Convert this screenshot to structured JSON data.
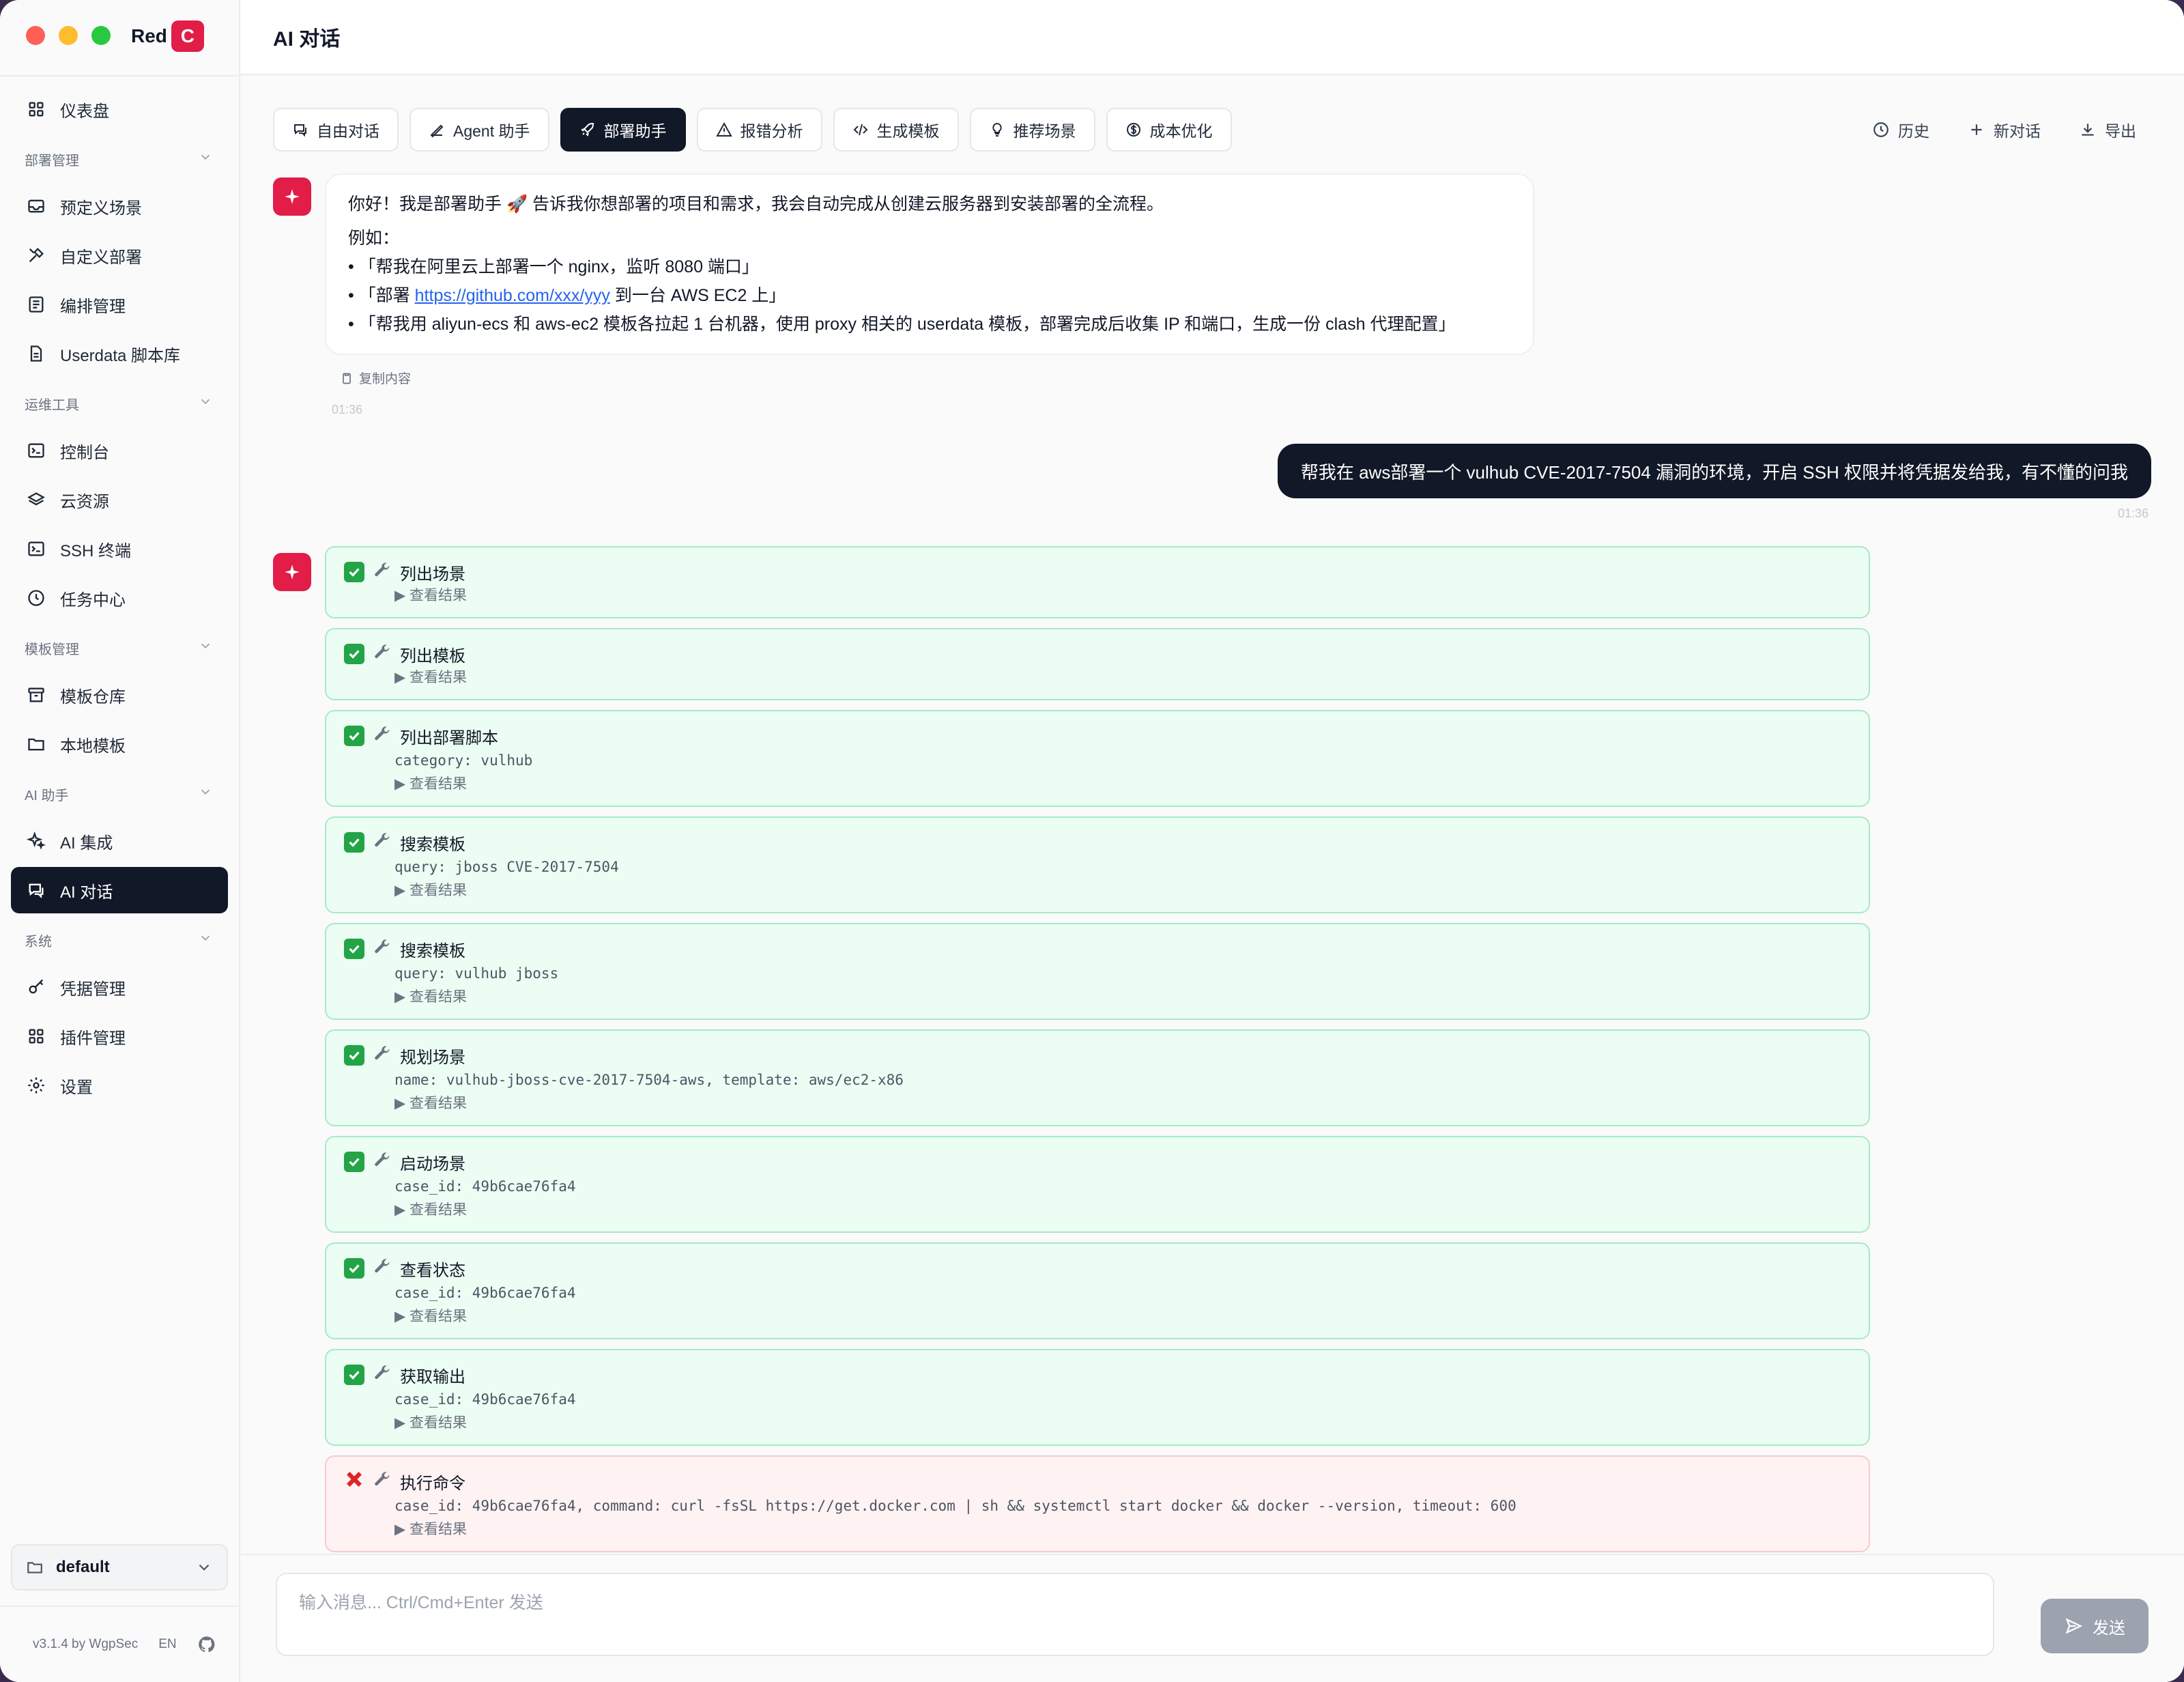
{
  "colors": {
    "accent": "#e11d48",
    "dark": "#111827",
    "success_bg": "#ecfdf3",
    "error_bg": "#fef2f2"
  },
  "app": {
    "logo_text": "Red",
    "logo_badge": "C"
  },
  "sidebar": {
    "top_item": {
      "label": "仪表盘",
      "icon": "grid-icon"
    },
    "sections": [
      {
        "title": "部署管理",
        "items": [
          {
            "label": "预定义场景",
            "icon": "inbox-icon"
          },
          {
            "label": "自定义部署",
            "icon": "tools-icon"
          },
          {
            "label": "编排管理",
            "icon": "list-icon"
          },
          {
            "label": "Userdata 脚本库",
            "icon": "file-icon"
          }
        ]
      },
      {
        "title": "运维工具",
        "items": [
          {
            "label": "控制台",
            "icon": "terminal-icon"
          },
          {
            "label": "云资源",
            "icon": "layers-icon"
          },
          {
            "label": "SSH 终端",
            "icon": "terminal-icon"
          },
          {
            "label": "任务中心",
            "icon": "clock-icon"
          }
        ]
      },
      {
        "title": "模板管理",
        "items": [
          {
            "label": "模板仓库",
            "icon": "archive-icon"
          },
          {
            "label": "本地模板",
            "icon": "folder-icon"
          }
        ]
      },
      {
        "title": "AI 助手",
        "items": [
          {
            "label": "AI 集成",
            "icon": "sparkles-icon"
          },
          {
            "label": "AI 对话",
            "icon": "chat-icon",
            "active": true
          }
        ]
      },
      {
        "title": "系统",
        "items": [
          {
            "label": "凭据管理",
            "icon": "key-icon"
          },
          {
            "label": "插件管理",
            "icon": "grid-icon"
          },
          {
            "label": "设置",
            "icon": "gear-icon"
          }
        ]
      }
    ],
    "workspace": "default",
    "version": "v3.1.4 by WgpSec",
    "lang": "EN"
  },
  "header": {
    "title": "AI 对话"
  },
  "modes": [
    {
      "label": "自由对话",
      "icon": "chat-icon"
    },
    {
      "label": "Agent 助手",
      "icon": "agent-icon"
    },
    {
      "label": "部署助手",
      "icon": "rocket-icon",
      "active": true
    },
    {
      "label": "报错分析",
      "icon": "warning-icon"
    },
    {
      "label": "生成模板",
      "icon": "code-icon"
    },
    {
      "label": "推荐场景",
      "icon": "bulb-icon"
    },
    {
      "label": "成本优化",
      "icon": "dollar-icon"
    }
  ],
  "actions": {
    "history": "历史",
    "new_chat": "新对话",
    "export": "导出"
  },
  "assistant_msg": {
    "intro": "你好！我是部署助手 🚀 告诉我你想部署的项目和需求，我会自动完成从创建云服务器到安装部署的全流程。",
    "example_label": "例如：",
    "ex1": "• 「帮我在阿里云上部署一个 nginx，监听 8080 端口」",
    "ex2_pre": "• 「部署 ",
    "ex2_link": "https://github.com/xxx/yyy",
    "ex2_post": " 到一台 AWS EC2 上」",
    "ex3": "• 「帮我用 aliyun-ecs 和 aws-ec2 模板各拉起 1 台机器，使用 proxy 相关的 userdata 模板，部署完成后收集 IP 和端口，生成一份 clash 代理配置」",
    "copy": "复制内容",
    "time": "01:36"
  },
  "user_msg": {
    "text": "帮我在 aws部署一个 vulhub CVE-2017-7504 漏洞的环境，开启 SSH 权限并将凭据发给我，有不懂的问我",
    "time": "01:36"
  },
  "tool_calls": [
    {
      "name": "列出场景",
      "args": "",
      "status": "success"
    },
    {
      "name": "列出模板",
      "args": "",
      "status": "success"
    },
    {
      "name": "列出部署脚本",
      "args": "category: vulhub",
      "status": "success"
    },
    {
      "name": "搜索模板",
      "args": "query: jboss CVE-2017-7504",
      "status": "success"
    },
    {
      "name": "搜索模板",
      "args": "query: vulhub jboss",
      "status": "success"
    },
    {
      "name": "规划场景",
      "args": "name: vulhub-jboss-cve-2017-7504-aws, template: aws/ec2-x86",
      "status": "success"
    },
    {
      "name": "启动场景",
      "args": "case_id: 49b6cae76fa4",
      "status": "success"
    },
    {
      "name": "查看状态",
      "args": "case_id: 49b6cae76fa4",
      "status": "success"
    },
    {
      "name": "获取输出",
      "args": "case_id: 49b6cae76fa4",
      "status": "success"
    },
    {
      "name": "执行命令",
      "args": "case_id: 49b6cae76fa4, command: curl -fsSL https://get.docker.com | sh && systemctl start docker && docker --version, timeout: 600",
      "status": "error"
    }
  ],
  "view_result": "▶ 查看结果",
  "input": {
    "placeholder": "输入消息... Ctrl/Cmd+Enter 发送",
    "send": "发送"
  }
}
